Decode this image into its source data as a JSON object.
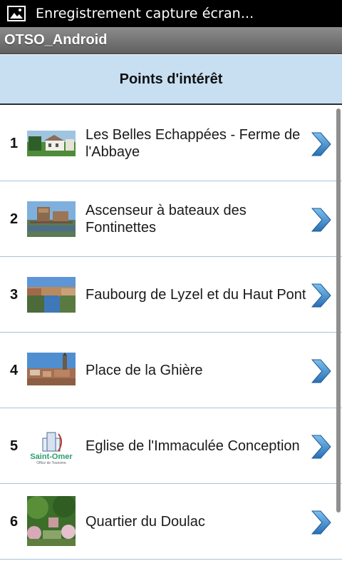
{
  "status_bar": {
    "icon": "image-notification-icon",
    "text": "Enregistrement capture écran..."
  },
  "app": {
    "title": "OTSO_Android"
  },
  "header": {
    "title": "Points d'intérêt"
  },
  "colors": {
    "header_bg": "#c7dff1",
    "chevron": "#3a86c9",
    "divider": "#a8c3d9"
  },
  "poi_list": [
    {
      "number": "1",
      "label": "Les Belles Echappées - Ferme de l'Abbaye",
      "thumb": "farm-photo"
    },
    {
      "number": "2",
      "label": "Ascenseur à bateaux des Fontinettes",
      "thumb": "boat-lift-photo"
    },
    {
      "number": "3",
      "label": "Faubourg de Lyzel et du Haut Pont",
      "thumb": "canal-photo"
    },
    {
      "number": "4",
      "label": "Place de la Ghière",
      "thumb": "town-square-photo"
    },
    {
      "number": "5",
      "label": "Eglise de l'Immaculée Conception",
      "thumb": "saint-omer-logo",
      "logo_text": "Saint-Omer",
      "logo_sub": "Office de Tourisme"
    },
    {
      "number": "6",
      "label": "Quartier du Doulac",
      "thumb": "garden-photo"
    }
  ]
}
